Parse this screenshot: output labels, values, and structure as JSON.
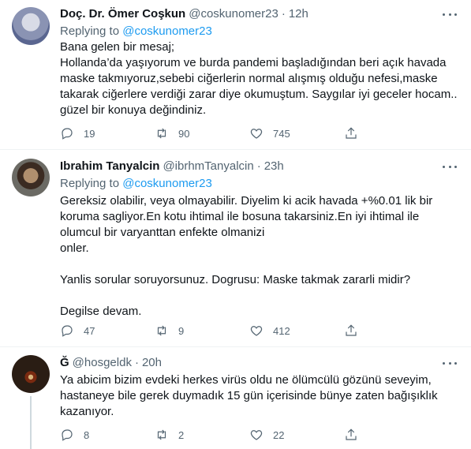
{
  "tweets": [
    {
      "name": "Doç. Dr. Ömer Coşkun",
      "handle": "@coskunomer23",
      "time": "12h",
      "replying_prefix": "Replying to ",
      "replying_to": "@coskunomer23",
      "text": "Bana gelen bir mesaj;\nHollanda’da yaşıyorum ve burda pandemi başladığından beri açık havada maske takmıyoruz,sebebi ciğerlerin normal alışmış olduğu nefesi,maske takarak ciğerlere verdiği zarar diye okumuştum. Saygılar iyi geceler hocam.. güzel bir konuya değindiniz.",
      "replies": "19",
      "retweets": "90",
      "likes": "745"
    },
    {
      "name": "Ibrahim Tanyalcin",
      "handle": "@ibrhmTanyalcin",
      "time": "23h",
      "replying_prefix": "Replying to ",
      "replying_to": "@coskunomer23",
      "text": "Gereksiz olabilir, veya olmayabilir. Diyelim ki acik havada +%0.01 lik bir koruma sagliyor.En kotu ihtimal ile bosuna takarsiniz.En iyi ihtimal ile olumcul bir varyanttan enfekte olmanizi\nonler.\n\nYanlis sorular soruyorsunuz. Dogrusu: Maske takmak zararli midir?\n\nDegilse devam.",
      "replies": "47",
      "retweets": "9",
      "likes": "412"
    },
    {
      "name": "Ğ",
      "handle": "@hosgeldk",
      "time": "20h",
      "text": "Ya abicim bizim evdeki herkes virüs oldu ne ölümcülü gözünü seveyim, hastaneye bile gerek duymadık 15 gün içerisinde bünye zaten bağışıklık kazanıyor.",
      "replies": "8",
      "retweets": "2",
      "likes": "22"
    }
  ],
  "separator": "·",
  "colors": {
    "accent": "#1d9bf0",
    "muted": "#536471",
    "text": "#0f1419",
    "border": "#eff3f4"
  },
  "icons": [
    "reply-icon",
    "retweet-icon",
    "like-icon",
    "share-icon",
    "more-icon"
  ]
}
